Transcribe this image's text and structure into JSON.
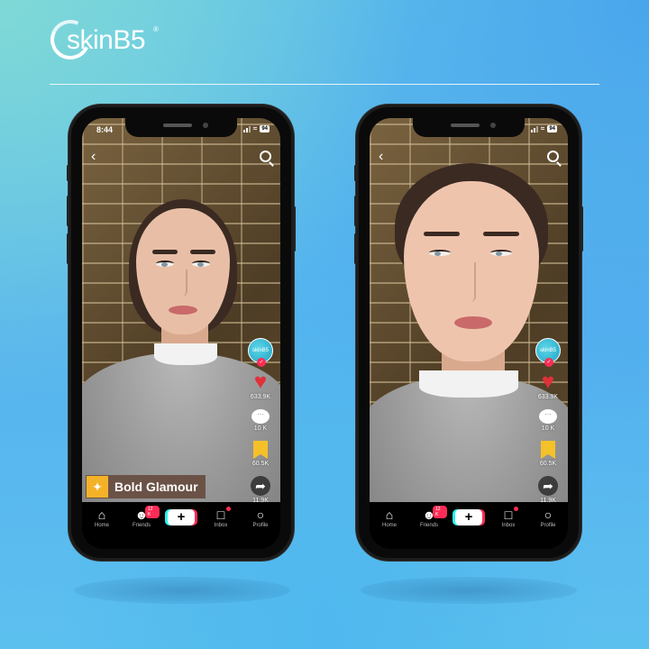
{
  "brand": {
    "logo_text": "skinB5",
    "registered": "®"
  },
  "phones": [
    {
      "id": "left",
      "status": {
        "time": "8:44",
        "battery": "94"
      },
      "rail": {
        "avatar_text": "skinB5",
        "likes": "633.9K",
        "comments": "10 K",
        "saves": "60.5K",
        "shares": "11.9K"
      },
      "effect": {
        "label": "Bold Glamour",
        "icon": "sparkle-wand-icon"
      },
      "nav": {
        "home": "Home",
        "friends": "Friends",
        "friends_badge": "12 K",
        "inbox": "Inbox",
        "profile": "Profile",
        "create": "+"
      }
    },
    {
      "id": "right",
      "status": {
        "time": "",
        "battery": "94"
      },
      "rail": {
        "avatar_text": "skinB5",
        "likes": "633.9K",
        "comments": "10 K",
        "saves": "60.5K",
        "shares": "11.9K"
      },
      "nav": {
        "home": "Home",
        "friends": "Friends",
        "friends_badge": "12 K",
        "inbox": "Inbox",
        "profile": "Profile",
        "create": "+"
      }
    }
  ],
  "colors": {
    "accent_pink": "#fe2c55",
    "accent_cyan": "#25f4ee",
    "like_red": "#e0303a",
    "save_yellow": "#f5c12a",
    "effect_bg": "#6b5246"
  }
}
